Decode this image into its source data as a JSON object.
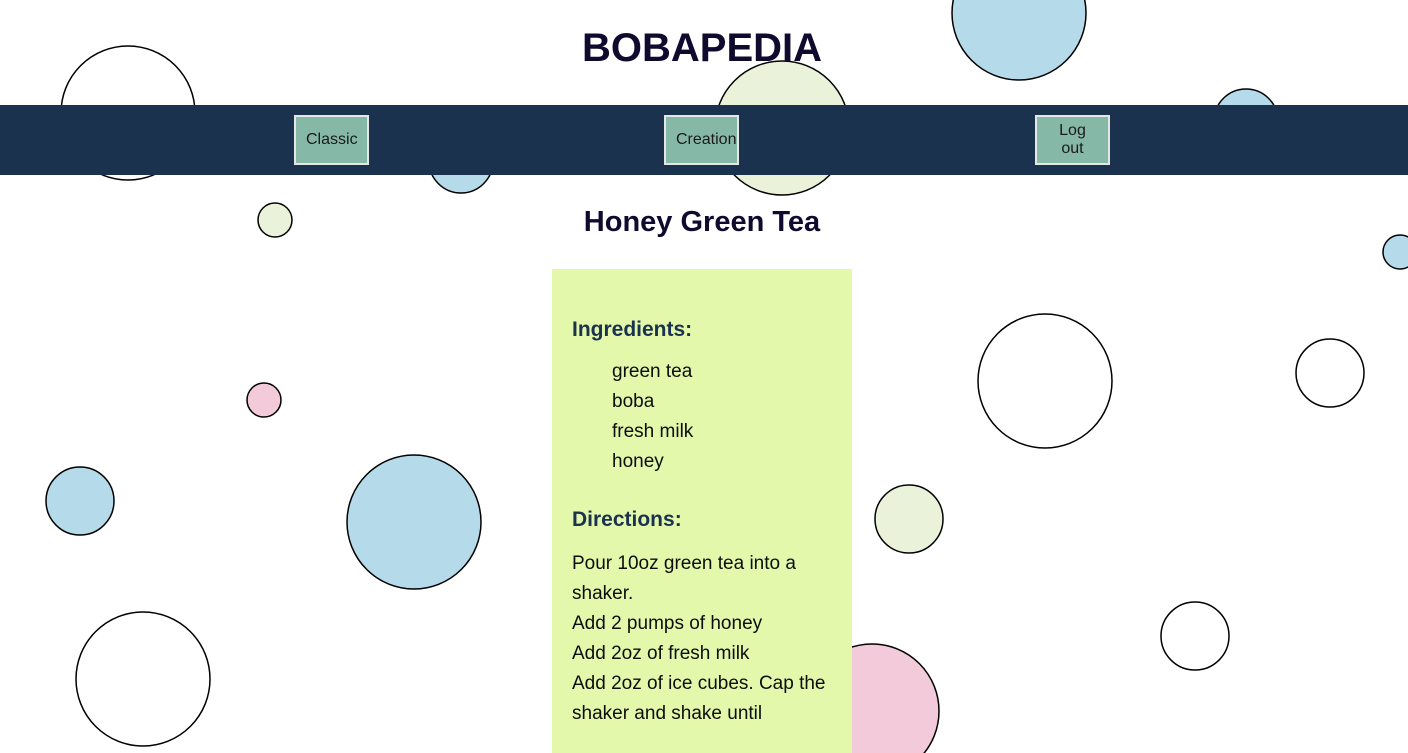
{
  "site": {
    "title": "BOBAPEDIA"
  },
  "nav": {
    "classic_label": "Classic",
    "creation_label": "Creation",
    "logout_label": "Log out"
  },
  "recipe": {
    "name": "Honey Green Tea",
    "ingredients_heading": "Ingredients:",
    "ingredients": [
      "green tea",
      "boba",
      "fresh milk",
      "honey"
    ],
    "directions_heading": "Directions:",
    "directions": [
      "Pour 10oz green tea into a shaker.",
      "Add 2 pumps of honey",
      "Add 2oz of fresh milk",
      "Add 2oz of ice cubes. Cap the shaker and shake until"
    ]
  },
  "colors": {
    "nav_bar": "#1b324f",
    "nav_button": "#86b8a8",
    "card": "#e3f8ab",
    "bubble_blue": "#b5dbea",
    "bubble_green": "#eaf3da",
    "bubble_pink": "#f3cad9",
    "bubble_white": "#ffffff"
  }
}
